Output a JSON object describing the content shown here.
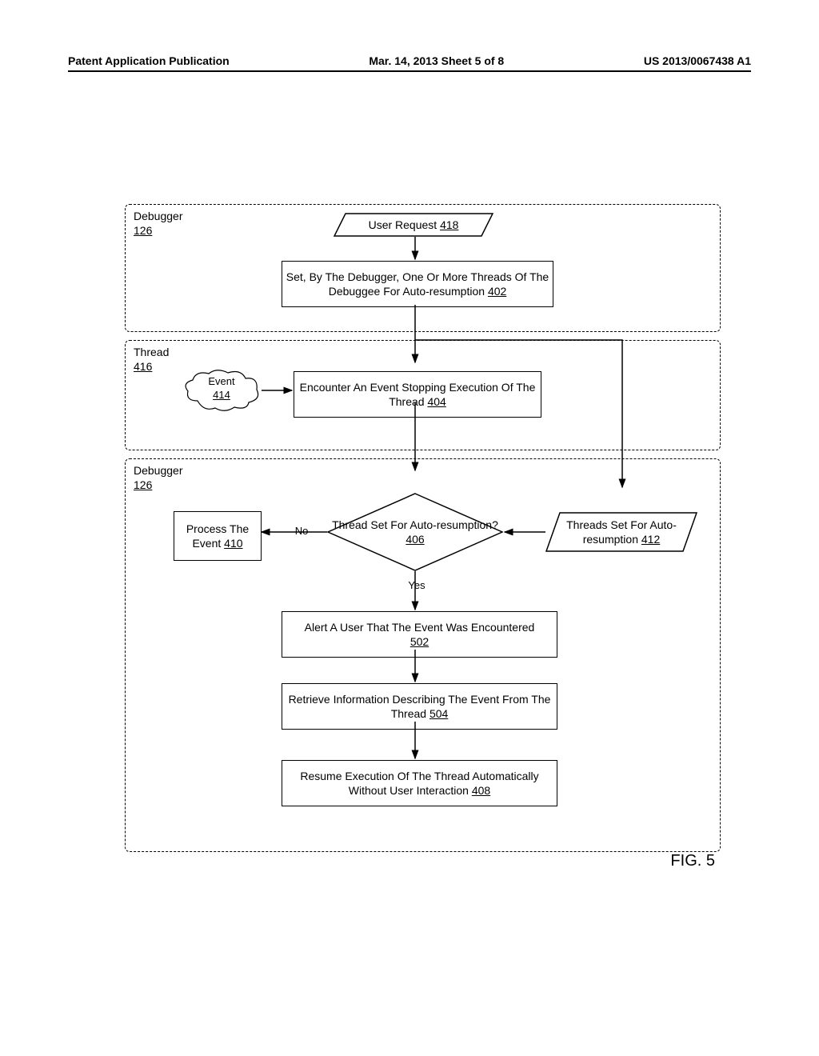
{
  "header": {
    "left": "Patent Application Publication",
    "center": "Mar. 14, 2013  Sheet 5 of 8",
    "right": "US 2013/0067438 A1"
  },
  "lanes": {
    "debugger1": {
      "title": "Debugger",
      "ref": "126"
    },
    "thread": {
      "title": "Thread",
      "ref": "416"
    },
    "debugger2": {
      "title": "Debugger",
      "ref": "126"
    }
  },
  "shapes": {
    "user_request": {
      "text": "User Request",
      "ref": "418"
    },
    "set_threads": {
      "text": "Set, By The Debugger, One Or More Threads Of The Debuggee For Auto-resumption",
      "ref": "402"
    },
    "event": {
      "text": "Event",
      "ref": "414"
    },
    "encounter": {
      "text": "Encounter An Event Stopping Execution Of The Thread",
      "ref": "404"
    },
    "process_event": {
      "text": "Process The Event",
      "ref": "410"
    },
    "decision": {
      "text": "Thread Set For Auto-resumption?",
      "ref": "406"
    },
    "threads_set": {
      "text": "Threads Set For Auto-resumption",
      "ref": "412"
    },
    "no_label": "No",
    "yes_label": "Yes",
    "alert": {
      "text": "Alert A User That The Event Was Encountered",
      "ref": "502"
    },
    "retrieve": {
      "text": "Retrieve Information Describing The Event From The Thread",
      "ref": "504"
    },
    "resume": {
      "text": "Resume Execution Of The Thread Automatically Without User Interaction",
      "ref": "408"
    }
  },
  "figure_label": "FIG. 5"
}
